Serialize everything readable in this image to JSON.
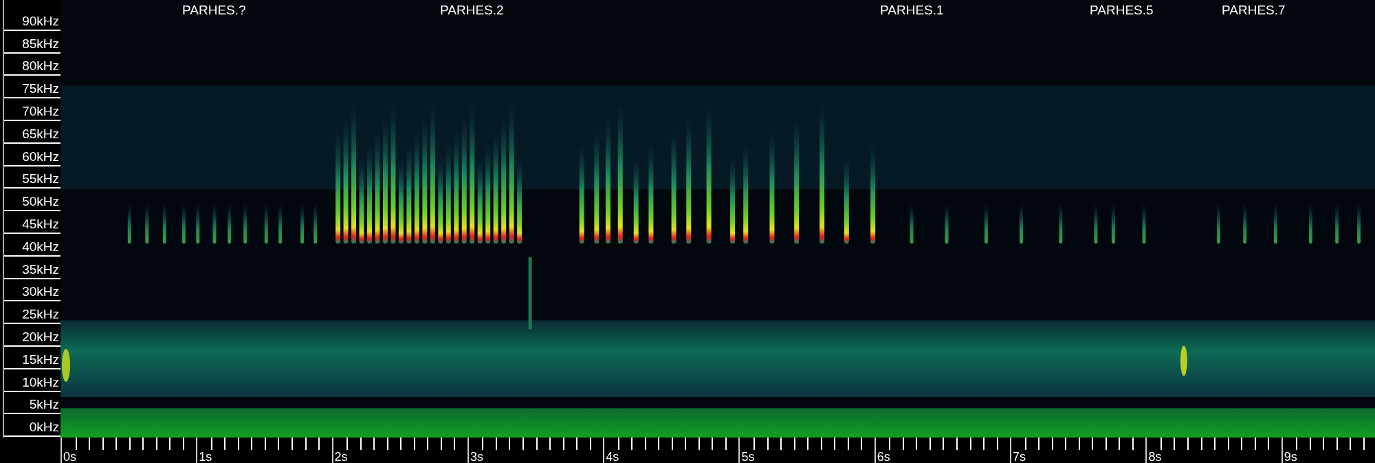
{
  "annotations": [
    {
      "label": "PARHES.?"
    },
    {
      "label": "PARHES.2"
    },
    {
      "label": "PARHES.1"
    },
    {
      "label": "PARHES.5"
    },
    {
      "label": "PARHES.7"
    }
  ],
  "frequency_axis": {
    "labels": [
      "90kHz",
      "85kHz",
      "80kHz",
      "75kHz",
      "70kHz",
      "65kHz",
      "60kHz",
      "55kHz",
      "50kHz",
      "45kHz",
      "40kHz",
      "35kHz",
      "30kHz",
      "25kHz",
      "20kHz",
      "15kHz",
      "10kHz",
      "5kHz",
      "0kHz"
    ]
  },
  "time_axis": {
    "labels": [
      "0s",
      "1s",
      "2s",
      "3s",
      "4s",
      "5s",
      "6s",
      "7s",
      "8s",
      "9s"
    ]
  }
}
